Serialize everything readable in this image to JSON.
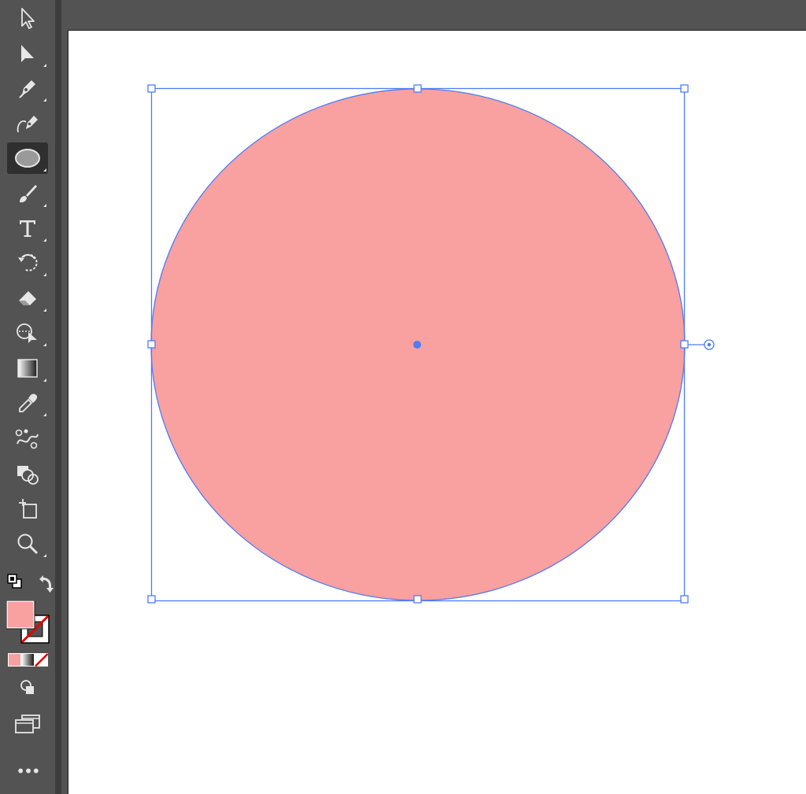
{
  "app": {
    "colors": {
      "panel": "#535353",
      "panel_edge": "#3c3c3c",
      "artboard": "#ffffff",
      "icon": "#e6e6e6",
      "active_tool": "#2f2f2f",
      "selection": "#4f7cf6"
    }
  },
  "toolbar": {
    "tools": [
      {
        "name": "selection-tool",
        "icon": "arrow-outline-icon",
        "active": false
      },
      {
        "name": "direct-selection-tool",
        "icon": "arrow-filled-icon",
        "active": false
      },
      {
        "name": "pen-tool",
        "icon": "pen-icon",
        "active": false
      },
      {
        "name": "curvature-tool",
        "icon": "curvature-pen-icon",
        "active": false
      },
      {
        "name": "ellipse-tool",
        "icon": "ellipse-icon",
        "active": true
      },
      {
        "name": "paintbrush-tool",
        "icon": "brush-icon",
        "active": false
      },
      {
        "name": "type-tool",
        "icon": "type-icon",
        "active": false
      },
      {
        "name": "rotate-tool",
        "icon": "rotate-icon",
        "active": false
      },
      {
        "name": "eraser-tool",
        "icon": "eraser-icon",
        "active": false
      },
      {
        "name": "puppet-warp-tool",
        "icon": "puppet-warp-icon",
        "active": false
      },
      {
        "name": "gradient-tool",
        "icon": "gradient-icon",
        "active": false
      },
      {
        "name": "eyedropper-tool",
        "icon": "eyedropper-icon",
        "active": false
      },
      {
        "name": "blend-tool",
        "icon": "blend-icon",
        "active": false
      },
      {
        "name": "shape-builder-tool",
        "icon": "shape-builder-icon",
        "active": false
      },
      {
        "name": "artboard-tool",
        "icon": "artboard-icon",
        "active": false
      },
      {
        "name": "zoom-tool",
        "icon": "zoom-icon",
        "active": false
      }
    ],
    "swatches": {
      "fill_color": "#f9a0a0",
      "stroke": "none"
    },
    "more_label": "•••"
  },
  "canvas": {
    "shape": {
      "type": "ellipse",
      "fill": "#f9a0a0",
      "stroke": "#4f7cf6"
    }
  }
}
